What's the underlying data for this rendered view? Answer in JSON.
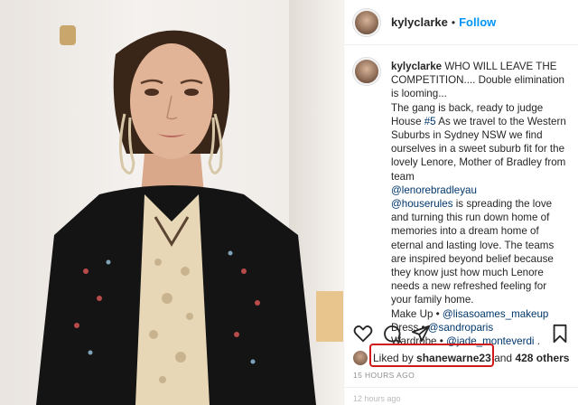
{
  "post": {
    "image": {
      "description_icon": "portrait-photo"
    },
    "author": "kylyclarke",
    "separator": "•",
    "follow_label": "Follow",
    "caption": {
      "username": "kylyclarke",
      "p1": " WHO WILL LEAVE THE COMPETITION.... Double elimination is looming...",
      "p2a": "The gang is back, ready to judge House ",
      "tag_house5": "#5",
      "p2b": " As we travel to the Western Suburbs in Sydney NSW we find ourselves in a sweet suburb fit for the lovely Lenore, Mother of Bradley from team ",
      "mention_lenore": "@lenorebradleyau",
      "mention_houserules": "@houserules",
      "p3": " is spreading the love and turning this run down home of memories into a dream home of eternal and lasting love. The teams are inspired beyond belief because they know just how much Lenore needs a new refreshed feeling for your family home.",
      "makeup_label": "Make Up • ",
      "makeup_handle": "@lisasoames_makeup",
      "dress_label": "Dress • ",
      "dress_handle": "@sandroparis",
      "wardrobe_label": "Wardrobe • ",
      "wardrobe_handle": "@jade_monteverdi",
      "wardrobe_tail": " ."
    },
    "likes": {
      "prefix": "Liked by ",
      "liker": "shanewarne23",
      "middle": " and ",
      "others": "428 others"
    },
    "timestamp": "15 HOURS AGO",
    "comment_hint": "12 hours ago"
  },
  "colors": {
    "accent": "#0095f6",
    "mention": "#00376b",
    "highlight": "#d01a1a"
  }
}
